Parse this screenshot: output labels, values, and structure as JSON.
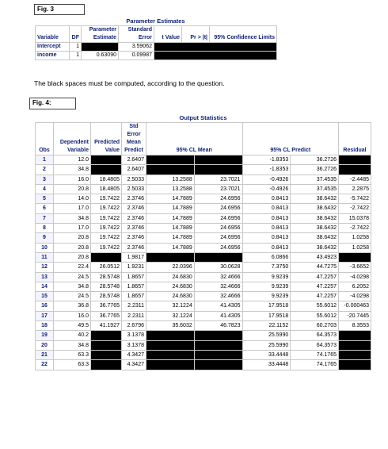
{
  "fig3_label": "Fig. 3",
  "param_title": "Parameter Estimates",
  "param_headers": {
    "variable": "Variable",
    "df": "DF",
    "estimate": "Parameter Estimate",
    "stderr": "Standard Error",
    "tvalue": "t Value",
    "pr": "Pr > |t|",
    "cl": "95% Confidence Limits"
  },
  "param_rows": [
    {
      "variable": "Intercept",
      "df": "1",
      "estimate": "",
      "stderr": "3.59062"
    },
    {
      "variable": "income",
      "df": "1",
      "estimate": "0.63090",
      "stderr": "0.09987"
    }
  ],
  "note": "The black spaces must be computed, according to the question.",
  "fig4_label": "Fig. 4:",
  "out_title": "Output Statistics",
  "out_headers": {
    "obs": "Obs",
    "dep": "Dependent Variable",
    "pred": "Predicted Value",
    "stderr": "Std Error Mean Predict",
    "clm": "95% CL Mean",
    "clp": "95% CL Predict",
    "resid": "Residual"
  },
  "out_rows": [
    {
      "obs": "1",
      "dep": "12.0",
      "pred": null,
      "se": "2.6407",
      "clm_lo": null,
      "clm_hi": null,
      "clp_lo": "-1.8353",
      "clp_hi": "36.2726",
      "resid": null
    },
    {
      "obs": "2",
      "dep": "34.8",
      "pred": null,
      "se": "2.6407",
      "clm_lo": null,
      "clm_hi": null,
      "clp_lo": "-1.8353",
      "clp_hi": "36.2726",
      "resid": null
    },
    {
      "obs": "3",
      "dep": "16.0",
      "pred": "18.4805",
      "se": "2.5033",
      "clm_lo": "13.2588",
      "clm_hi": "23.7021",
      "clp_lo": "-0.4926",
      "clp_hi": "37.4535",
      "resid": "-2.4485"
    },
    {
      "obs": "4",
      "dep": "20.8",
      "pred": "18.4805",
      "se": "2.5033",
      "clm_lo": "13.2588",
      "clm_hi": "23.7021",
      "clp_lo": "-0.4926",
      "clp_hi": "37.4535",
      "resid": "2.2875"
    },
    {
      "obs": "5",
      "dep": "14.0",
      "pred": "19.7422",
      "se": "2.3746",
      "clm_lo": "14.7889",
      "clm_hi": "24.6956",
      "clp_lo": "0.8413",
      "clp_hi": "38.6432",
      "resid": "-5.7422"
    },
    {
      "obs": "6",
      "dep": "17.0",
      "pred": "19.7422",
      "se": "2.3746",
      "clm_lo": "14.7889",
      "clm_hi": "24.6956",
      "clp_lo": "0.8413",
      "clp_hi": "38.6432",
      "resid": "-2.7422"
    },
    {
      "obs": "7",
      "dep": "34.8",
      "pred": "19.7422",
      "se": "2.3746",
      "clm_lo": "14.7889",
      "clm_hi": "24.6956",
      "clp_lo": "0.8413",
      "clp_hi": "38.6432",
      "resid": "15.0378"
    },
    {
      "obs": "8",
      "dep": "17.0",
      "pred": "19.7422",
      "se": "2.3746",
      "clm_lo": "14.7889",
      "clm_hi": "24.6956",
      "clp_lo": "0.8413",
      "clp_hi": "38.6432",
      "resid": "-2.7422"
    },
    {
      "obs": "9",
      "dep": "20.8",
      "pred": "19.7422",
      "se": "2.3746",
      "clm_lo": "14.7889",
      "clm_hi": "24.6956",
      "clp_lo": "0.8413",
      "clp_hi": "38.6432",
      "resid": "1.0258"
    },
    {
      "obs": "10",
      "dep": "20.8",
      "pred": "19.7422",
      "se": "2.3746",
      "clm_lo": "14.7889",
      "clm_hi": "24.6956",
      "clp_lo": "0.8413",
      "clp_hi": "38.6432",
      "resid": "1.0258"
    },
    {
      "obs": "11",
      "dep": "20.8",
      "pred": null,
      "se": "1.9817",
      "clm_lo": null,
      "clm_hi": null,
      "clp_lo": "6.0866",
      "clp_hi": "43.4923",
      "resid": null
    },
    {
      "obs": "12",
      "dep": "22.4",
      "pred": "26.0512",
      "se": "1.9231",
      "clm_lo": "22.0396",
      "clm_hi": "30.0628",
      "clp_lo": "7.3750",
      "clp_hi": "44.7275",
      "resid": "-3.6652"
    },
    {
      "obs": "13",
      "dep": "24.5",
      "pred": "28.5748",
      "se": "1.8657",
      "clm_lo": "24.6830",
      "clm_hi": "32.4666",
      "clp_lo": "9.9239",
      "clp_hi": "47.2257",
      "resid": "-4.0298"
    },
    {
      "obs": "14",
      "dep": "34.8",
      "pred": "28.5748",
      "se": "1.8657",
      "clm_lo": "24.6830",
      "clm_hi": "32.4666",
      "clp_lo": "9.9239",
      "clp_hi": "47.2257",
      "resid": "6.2052"
    },
    {
      "obs": "15",
      "dep": "24.5",
      "pred": "28.5748",
      "se": "1.8657",
      "clm_lo": "24.6830",
      "clm_hi": "32.4666",
      "clp_lo": "9.9239",
      "clp_hi": "47.2257",
      "resid": "-4.0298"
    },
    {
      "obs": "16",
      "dep": "36.8",
      "pred": "36.7765",
      "se": "2.2311",
      "clm_lo": "32.1224",
      "clm_hi": "41.4305",
      "clp_lo": "17.9518",
      "clp_hi": "55.6012",
      "resid": "-0.000463"
    },
    {
      "obs": "17",
      "dep": "16.0",
      "pred": "36.7765",
      "se": "2.2311",
      "clm_lo": "32.1224",
      "clm_hi": "41.4305",
      "clp_lo": "17.9518",
      "clp_hi": "55.6012",
      "resid": "-20.7445"
    },
    {
      "obs": "18",
      "dep": "49.5",
      "pred": "41.1927",
      "se": "2.6796",
      "clm_lo": "35.6032",
      "clm_hi": "46.7823",
      "clp_lo": "22.1152",
      "clp_hi": "60.2703",
      "resid": "8.3553"
    },
    {
      "obs": "19",
      "dep": "40.2",
      "pred": null,
      "se": "3.1378",
      "clm_lo": null,
      "clm_hi": null,
      "clp_lo": "25.5990",
      "clp_hi": "64.3573",
      "resid": null
    },
    {
      "obs": "20",
      "dep": "34.8",
      "pred": null,
      "se": "3.1378",
      "clm_lo": null,
      "clm_hi": null,
      "clp_lo": "25.5990",
      "clp_hi": "64.3573",
      "resid": null
    },
    {
      "obs": "21",
      "dep": "63.3",
      "pred": null,
      "se": "4.3427",
      "clm_lo": null,
      "clm_hi": null,
      "clp_lo": "33.4448",
      "clp_hi": "74.1765",
      "resid": null
    },
    {
      "obs": "22",
      "dep": "63.3",
      "pred": null,
      "se": "4.3427",
      "clm_lo": null,
      "clm_hi": null,
      "clp_lo": "33.4448",
      "clp_hi": "74.1765",
      "resid": null
    }
  ]
}
